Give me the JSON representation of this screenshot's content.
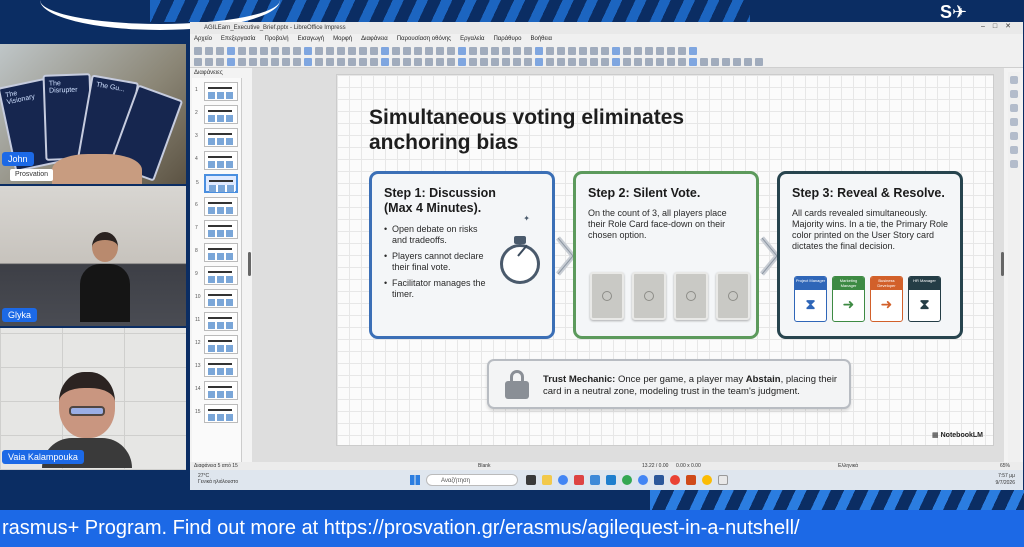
{
  "stream": {
    "brand": "streamyard",
    "ticker": "rasmus+ Program. Find out more at https://prosvation.gr/erasmus/agilequest-in-a-nutshell/"
  },
  "participants": [
    {
      "name": "John",
      "org": "Prosvation",
      "cards": [
        "The Visionary",
        "The Disrupter",
        "The Gu..."
      ]
    },
    {
      "name": "Glyka"
    },
    {
      "name": "Vaia Kalampouka"
    }
  ],
  "window": {
    "title": "AGILEarn_Executive_Brief.pptx - LibreOffice Impress",
    "menu": [
      "Αρχείο",
      "Επεξεργασία",
      "Προβολή",
      "Εισαγωγή",
      "Μορφή",
      "Διαφάνεια",
      "Παρουσίαση οθόνης",
      "Εργαλεία",
      "Παράθυρο",
      "Βοήθεια"
    ],
    "slides_panel_title": "Διαφάνειες",
    "thumb_numbers": [
      "1",
      "2",
      "3",
      "4",
      "5",
      "6",
      "7",
      "8",
      "9",
      "10",
      "11",
      "12",
      "13",
      "14",
      "15"
    ],
    "status_slide": "Διαφάνεια 5 από 15",
    "status_layout": "Blank",
    "status_coords": "13.22 / 0.00",
    "status_size": "0.00 x 0.00",
    "status_lang": "Ελληνικά",
    "status_zoom": "65%"
  },
  "slide": {
    "title": "Simultaneous voting eliminates anchoring bias",
    "step1": {
      "title": "Step 1: Discussion (Max 4 Minutes).",
      "bullets": [
        "Open debate on risks and tradeoffs.",
        "Players cannot declare their final vote.",
        "Facilitator manages the timer."
      ]
    },
    "step2": {
      "title": "Step 2: Silent Vote.",
      "body": "On the count of 3, all players place their Role Card face-down on their chosen option."
    },
    "step3": {
      "title": "Step 3: Reveal & Resolve.",
      "body": "All cards revealed simultaneously. Majority wins. In a tie, the Primary Role color printed on the User Story card dictates the final decision.",
      "roles": [
        {
          "label": "Project Manager",
          "color": "#2f66b8",
          "symbol": "⧗"
        },
        {
          "label": "Marketing Manager",
          "color": "#3d8a43",
          "symbol": "➜"
        },
        {
          "label": "Business Developer",
          "color": "#d2602a",
          "symbol": "➜"
        },
        {
          "label": "HR Manager",
          "color": "#243d46",
          "symbol": "⧗"
        }
      ]
    },
    "trust": {
      "label": "Trust Mechanic:",
      "pre": " Once per game, a player may ",
      "bold": "Abstain",
      "post": ", placing their card in a neutral zone, modeling trust in the team's judgment."
    },
    "watermark": "NotebookLM"
  },
  "taskbar": {
    "search_placeholder": "Αναζήτηση",
    "weather_temp": "27°C",
    "weather_desc": "Γενικά ηλιόλουστο",
    "time": "7:57 μμ",
    "date": "9/7/2026"
  },
  "colors": {
    "accent": "#1c69e6",
    "navy": "#0b2d63"
  }
}
